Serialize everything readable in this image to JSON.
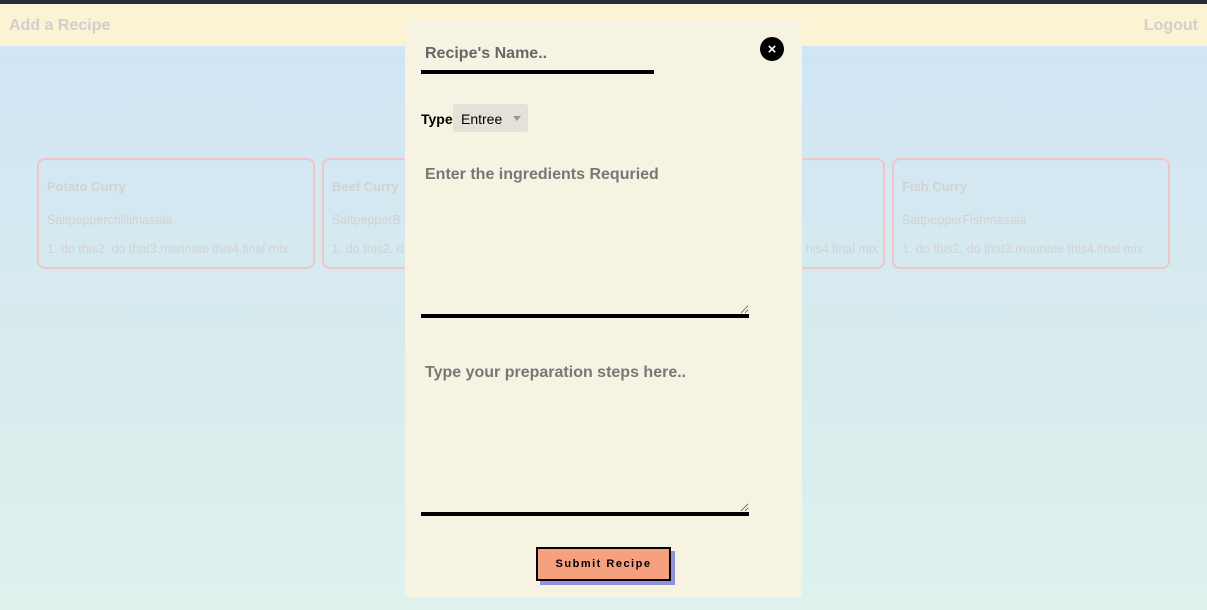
{
  "header": {
    "add_recipe": "Add a Recipe",
    "logout": "Logout"
  },
  "cards": [
    {
      "title": "Potato Curry",
      "ingredients": "Saltpepperchillimasala",
      "steps": "1. do this2. do that3.marinate this4.final mix"
    },
    {
      "title": "Beef Curry",
      "ingredients": "SaltpepperB",
      "steps": "1. do this2. d"
    },
    {
      "title": "",
      "ingredients": "",
      "steps": "his4.final mix"
    },
    {
      "title": "Fish Curry",
      "ingredients": "SaltpepperFishmasala",
      "steps": "1. do this2. do that3.marinate this4.final mix"
    }
  ],
  "modal": {
    "name_placeholder": "Recipe's Name..",
    "close_icon": "×",
    "type_label": "Type",
    "type_selected": "Entree",
    "ingredients_placeholder": "Enter the ingredients Requried",
    "steps_placeholder": "Type your preparation steps here..",
    "submit_label": "Submit Recipe"
  },
  "colors": {
    "header_bg": "#fbf3d4",
    "modal_bg": "#f7f3e2",
    "submit_bg": "#f5a07f",
    "submit_shadow": "#8f93d9",
    "card_border": "#efc6c3"
  }
}
